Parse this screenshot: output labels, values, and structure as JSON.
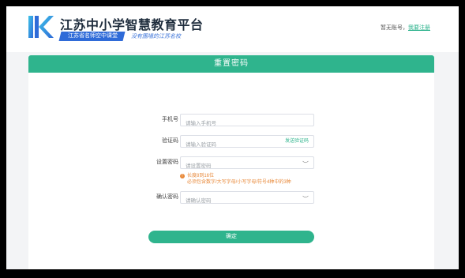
{
  "header": {
    "site_title": "江苏中小学智慧教育平台",
    "badge": "江苏省名师空中课堂",
    "slogan": "没有围墙的江苏名校",
    "account_prompt": "暂无账号，",
    "register_link": "我要注册"
  },
  "card": {
    "title": "重置密码"
  },
  "form": {
    "phone": {
      "label": "手机号",
      "placeholder": "请输入手机号"
    },
    "code": {
      "label": "验证码",
      "placeholder": "请输入验证码",
      "send_label": "发送验证码"
    },
    "password": {
      "label": "设置密码",
      "placeholder": "请设置密码"
    },
    "hint": {
      "icon": "!",
      "line1": "长度8到16位",
      "line2": "必须包含数字/大写字母/小写字母/符号4种中的3种"
    },
    "confirm": {
      "label": "确认密码",
      "placeholder": "请确认密码"
    },
    "submit_label": "确定"
  },
  "colors": {
    "accent": "#2fb48d",
    "brand_blue": "#2f6bd8",
    "warning": "#e8893a"
  }
}
